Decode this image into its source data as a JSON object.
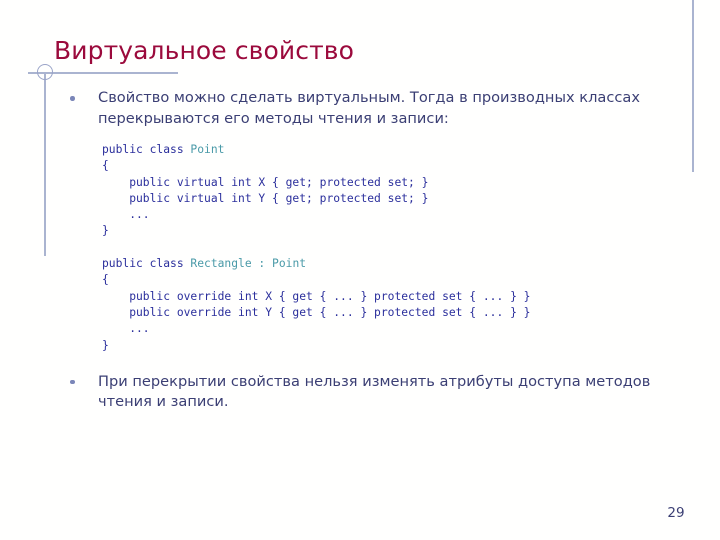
{
  "slide": {
    "title": "Виртуальное свойство",
    "page_number": "29",
    "colors": {
      "title": "#9b0a3c",
      "body_text": "#3b3f74",
      "code_keyword": "#2b2f9c",
      "code_type": "#4a9aa8",
      "decoration": "#aab4d0",
      "bullet": "#7b86b8"
    }
  },
  "bullets": [
    {
      "text": "Свойство можно сделать виртуальным. Тогда в производных классах перекрываются его методы чтения и записи:"
    },
    {
      "text": "При перекрытии свойства нельзя изменять атрибуты доступа методов чтения и записи."
    }
  ],
  "code": {
    "lines": [
      {
        "parts": [
          {
            "t": "public class ",
            "k": "kw"
          },
          {
            "t": "Point",
            "k": "type"
          }
        ]
      },
      {
        "parts": [
          {
            "t": "{",
            "k": "kw"
          }
        ]
      },
      {
        "parts": [
          {
            "t": "    public virtual int X { get; protected set; }",
            "k": "kw"
          }
        ]
      },
      {
        "parts": [
          {
            "t": "    public virtual int Y { get; protected set; }",
            "k": "kw"
          }
        ]
      },
      {
        "parts": [
          {
            "t": "    ...",
            "k": "kw"
          }
        ]
      },
      {
        "parts": [
          {
            "t": "}",
            "k": "kw"
          }
        ]
      },
      {
        "parts": []
      },
      {
        "parts": [
          {
            "t": "public class ",
            "k": "kw"
          },
          {
            "t": "Rectangle : Point",
            "k": "type"
          }
        ]
      },
      {
        "parts": [
          {
            "t": "{",
            "k": "kw"
          }
        ]
      },
      {
        "parts": [
          {
            "t": "    public override int X { get { ... } protected set { ... } }",
            "k": "kw"
          }
        ]
      },
      {
        "parts": [
          {
            "t": "    public override int Y { get { ... } protected set { ... } }",
            "k": "kw"
          }
        ]
      },
      {
        "parts": [
          {
            "t": "    ...",
            "k": "kw"
          }
        ]
      },
      {
        "parts": [
          {
            "t": "}",
            "k": "kw"
          }
        ]
      }
    ]
  }
}
